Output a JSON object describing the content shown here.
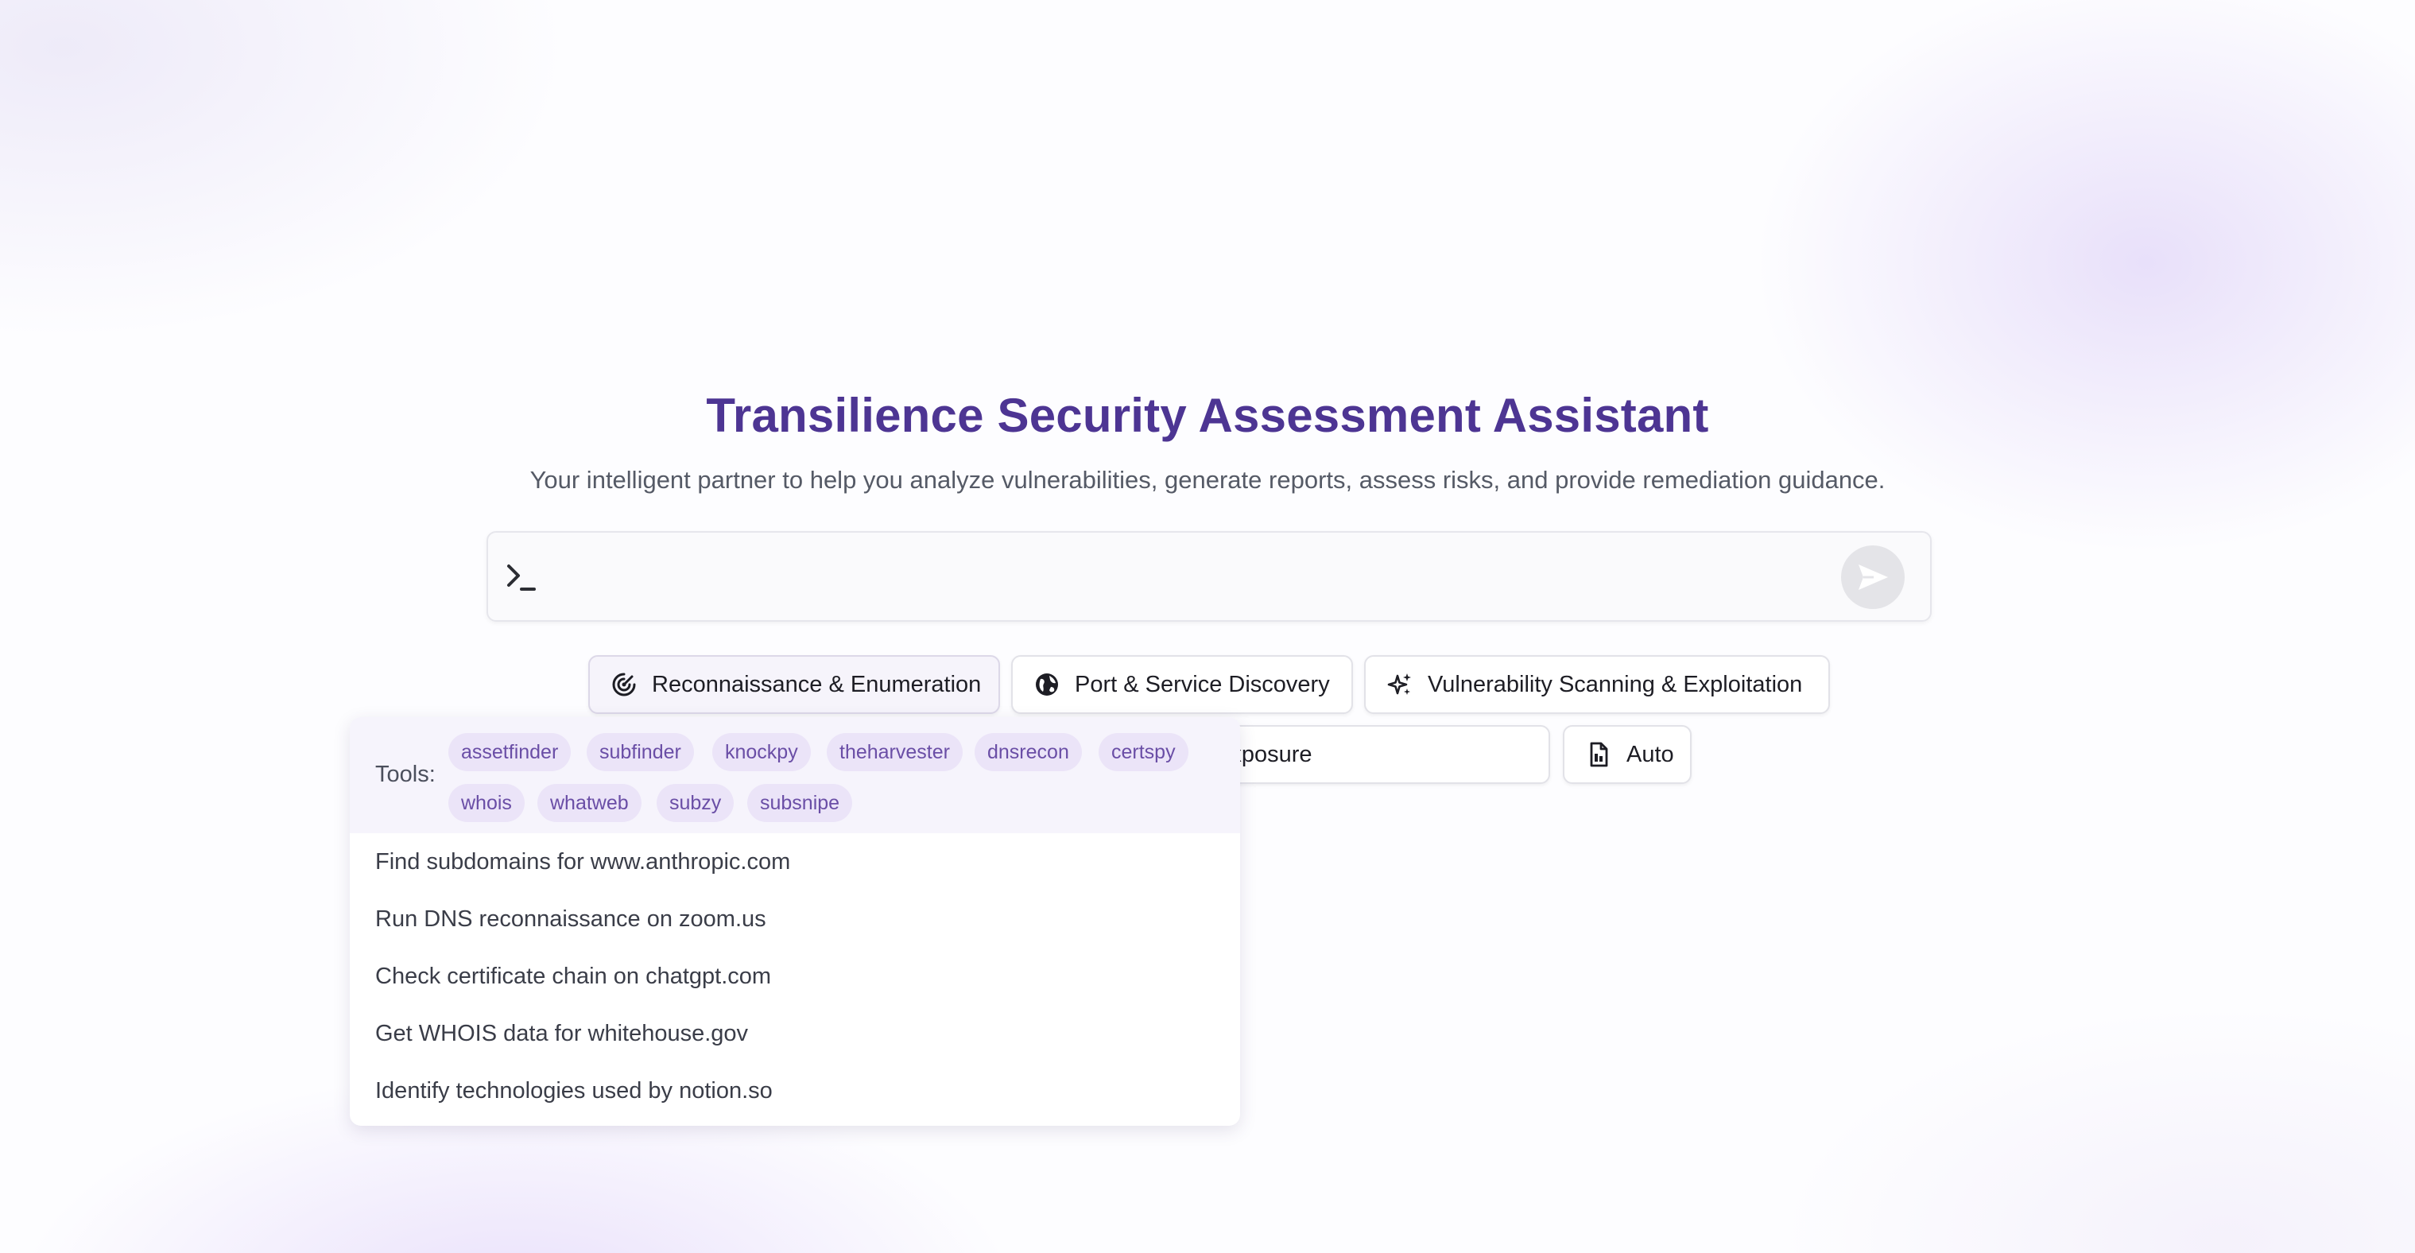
{
  "header": {
    "title": "Transilience Security Assessment Assistant",
    "subtitle": "Your intelligent partner to help you analyze vulnerabilities, generate reports, assess risks, and provide remediation guidance."
  },
  "prompt": {
    "placeholder": "",
    "value": "",
    "icon": "terminal-prompt-icon",
    "send_icon": "send-icon"
  },
  "categories": [
    {
      "label": "Reconnaissance & Enumeration",
      "icon": "radar-icon",
      "active": true
    },
    {
      "label": "Port & Service Discovery",
      "icon": "globe-icon",
      "active": false
    },
    {
      "label": "Vulnerability Scanning & Exploitation",
      "icon": "sparkles-icon",
      "active": false
    },
    {
      "label": "Secrets & Credential Exposure",
      "icon": "key-icon",
      "active": false
    },
    {
      "label": "Auto",
      "icon": "document-icon",
      "active": false
    }
  ],
  "dropdown": {
    "tools_label": "Tools:",
    "tools": [
      "assetfinder",
      "subfinder",
      "knockpy",
      "theharvester",
      "dnsrecon",
      "certspy",
      "whois",
      "whatweb",
      "subzy",
      "subsnipe"
    ],
    "suggestions": [
      "Find subdomains for www.anthropic.com",
      "Run DNS reconnaissance on zoom.us",
      "Check certificate chain on chatgpt.com",
      "Get WHOIS data for whitehouse.gov",
      "Identify technologies used by notion.so"
    ]
  },
  "colors": {
    "title": "#4d3593",
    "tag_bg": "#ebe4f8",
    "tag_text": "#6a4ea6",
    "tools_panel_bg": "#f6f4fc"
  }
}
